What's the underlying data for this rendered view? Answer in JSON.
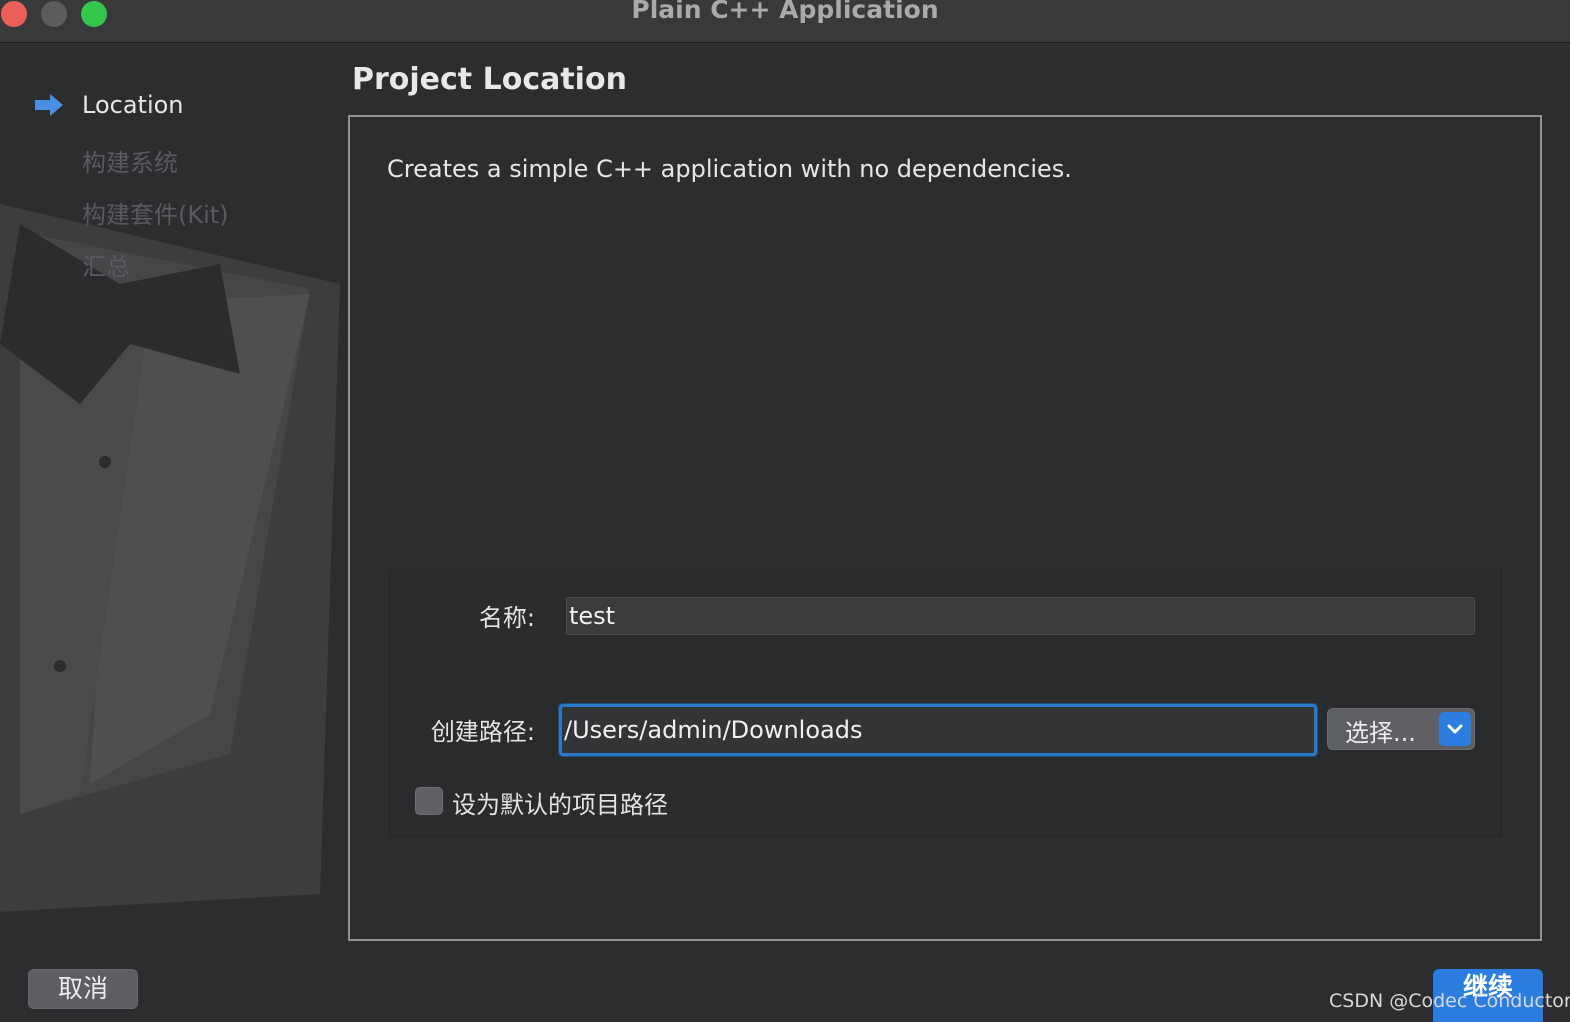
{
  "window": {
    "title": "Plain C++ Application"
  },
  "sidebar": {
    "steps": [
      {
        "label": "Location",
        "active": true
      },
      {
        "label": "构建系统",
        "active": false
      },
      {
        "label": "构建套件(Kit)",
        "active": false
      },
      {
        "label": "汇总",
        "active": false
      }
    ]
  },
  "main": {
    "page_title": "Project Location",
    "description": "Creates a simple C++ application with no dependencies.",
    "form": {
      "name_label": "名称:",
      "name_value": "test",
      "path_label": "创建路径:",
      "path_value": "/Users/admin/Downloads",
      "choose_button": "选择...",
      "default_checkbox_label": "设为默认的项目路径",
      "default_checkbox_checked": false
    }
  },
  "footer": {
    "cancel_label": "取消",
    "continue_label": "继续"
  },
  "watermark": "CSDN @Codec Conductor",
  "colors": {
    "accent": "#2b7de0",
    "background": "#2c2d2f",
    "close": "#ec5f57",
    "maximize": "#34c749"
  }
}
